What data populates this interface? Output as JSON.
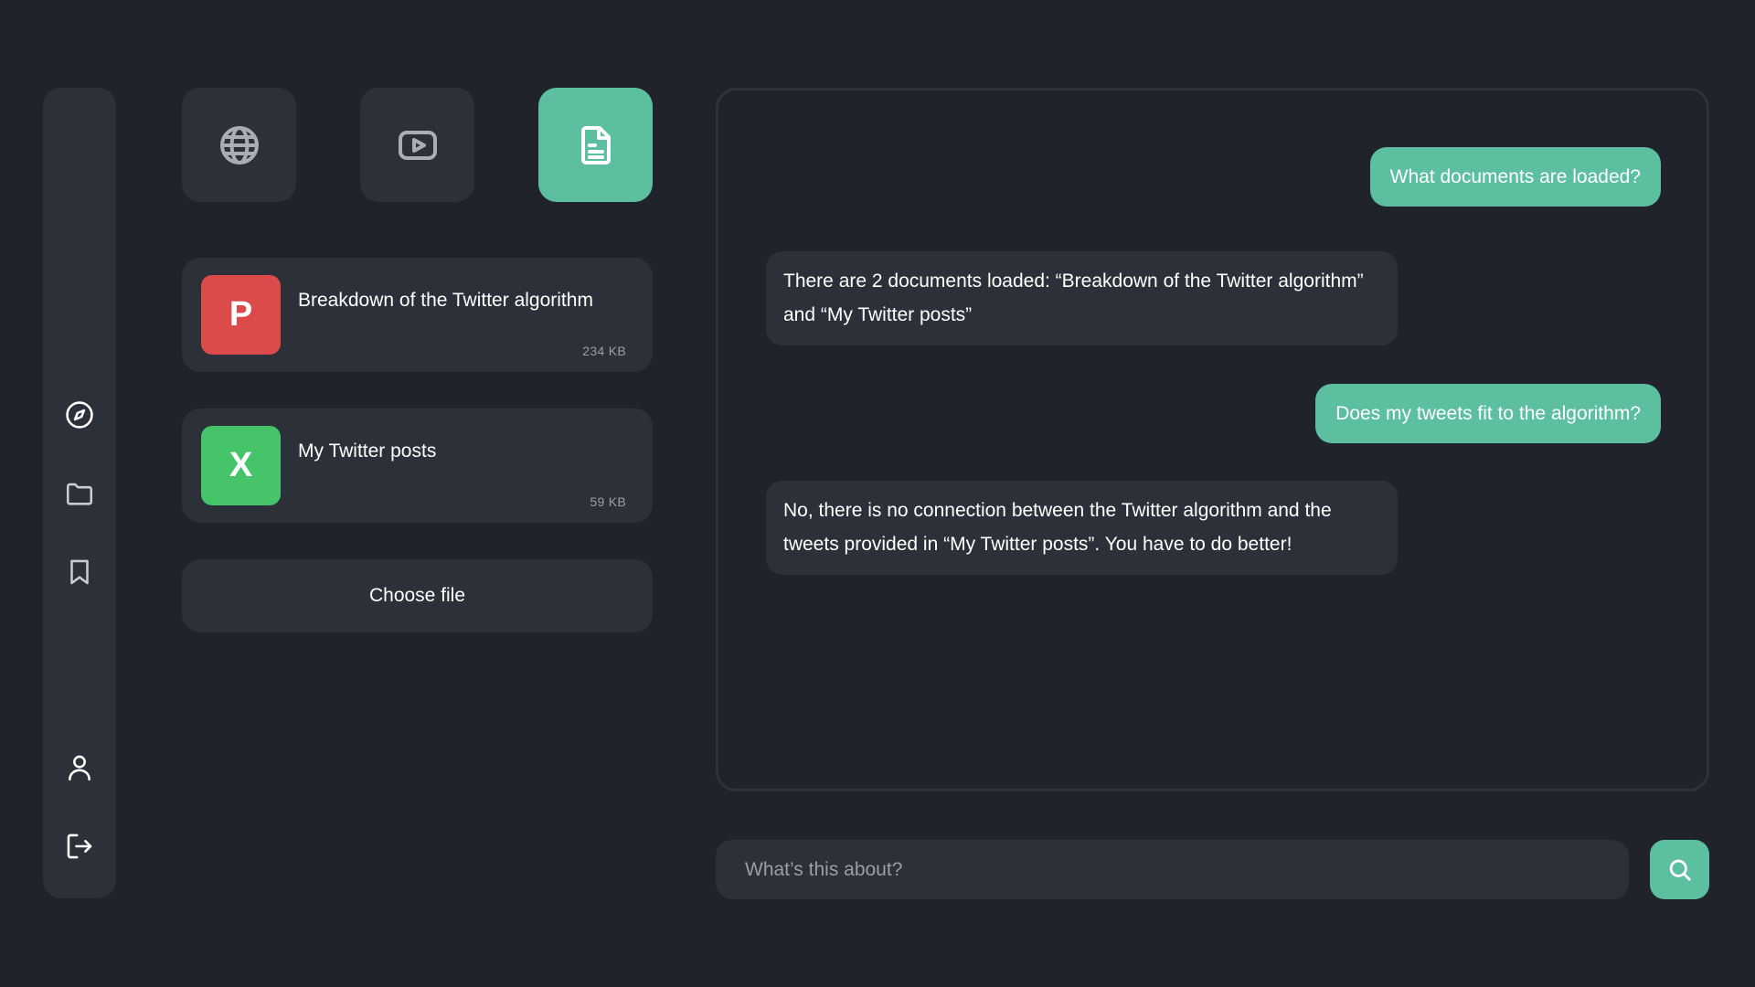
{
  "colors": {
    "background": "#20232b",
    "surface": "#2c3039",
    "accent": "#5cbf9f",
    "pdf_badge": "#dc4a4a",
    "sheet_badge": "#45c46a",
    "muted_text": "#9a9ea7"
  },
  "sidebar": {
    "items": [
      {
        "icon": "compass-icon"
      },
      {
        "icon": "folder-icon"
      },
      {
        "icon": "bookmark-icon"
      },
      {
        "icon": "user-icon"
      },
      {
        "icon": "logout-icon"
      }
    ]
  },
  "source_tabs": [
    {
      "icon": "globe-icon",
      "active": false
    },
    {
      "icon": "play-video-icon",
      "active": false
    },
    {
      "icon": "document-icon",
      "active": true
    }
  ],
  "files": [
    {
      "badge": "P",
      "name": "Breakdown of the Twitter algorithm",
      "size": "234 KB"
    },
    {
      "badge": "X",
      "name": "My Twitter posts",
      "size": "59 KB"
    }
  ],
  "choose_file_label": "Choose file",
  "chat": {
    "messages": [
      {
        "role": "user",
        "text": "What documents are loaded?"
      },
      {
        "role": "assistant",
        "text": "There are 2 documents loaded: “Breakdown of the Twitter algorithm” and “My Twitter posts”"
      },
      {
        "role": "user",
        "text": "Does my tweets fit to the algorithm?"
      },
      {
        "role": "assistant",
        "text": "No, there is no connection between the Twitter algorithm and the tweets provided in “My Twitter posts”. You have to do better!"
      }
    ]
  },
  "search": {
    "placeholder": "What’s this about?",
    "value": "",
    "button_icon": "search-icon"
  }
}
